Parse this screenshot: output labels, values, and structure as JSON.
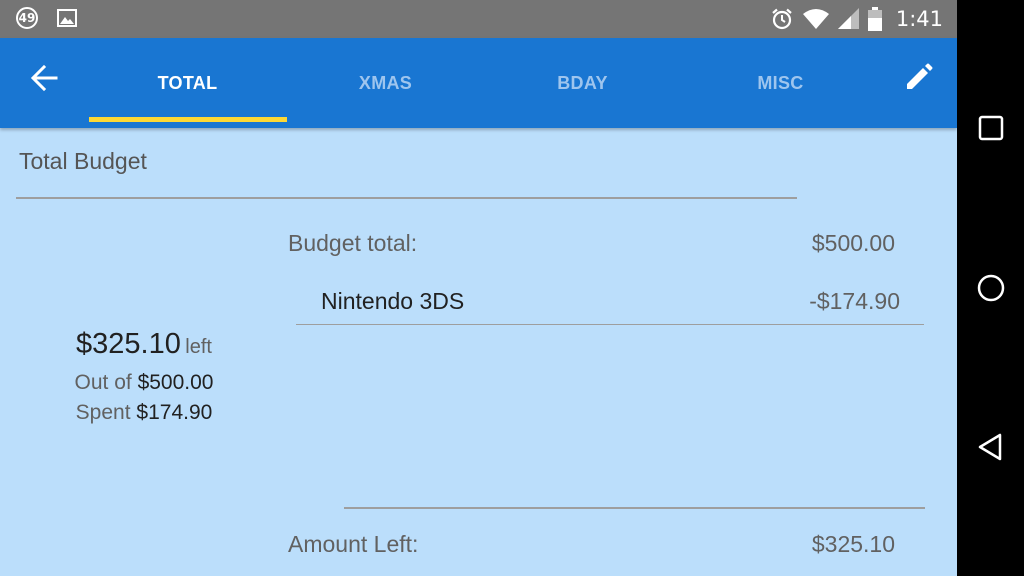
{
  "status_bar": {
    "notification_count": "49",
    "time": "1:41",
    "icons": [
      "image-icon",
      "alarm-icon",
      "wifi-icon",
      "signal-icon",
      "battery-icon"
    ]
  },
  "app_bar": {
    "back_icon": "arrow-left-icon",
    "edit_icon": "pencil-icon",
    "tabs": [
      {
        "label": "TOTAL",
        "active": true
      },
      {
        "label": "XMAS",
        "active": false
      },
      {
        "label": "BDAY",
        "active": false
      },
      {
        "label": "MISC",
        "active": false
      }
    ],
    "indicator_color": "#fdd835",
    "background_color": "#1976d2"
  },
  "budget": {
    "title": "Total Budget",
    "total_label": "Budget total:",
    "total_value": "$500.00",
    "expenses": [
      {
        "name": "Nintendo 3DS",
        "amount": "-$174.90"
      }
    ],
    "left_amount": "$325.10",
    "left_word": "left",
    "out_of_label": "Out of",
    "out_of_value": "$500.00",
    "spent_label": "Spent",
    "spent_value": "$174.90",
    "amount_left_label": "Amount Left:",
    "amount_left_value": "$325.10"
  },
  "nav_bar": {
    "buttons": [
      "recents-square-icon",
      "home-circle-icon",
      "back-triangle-icon"
    ]
  }
}
